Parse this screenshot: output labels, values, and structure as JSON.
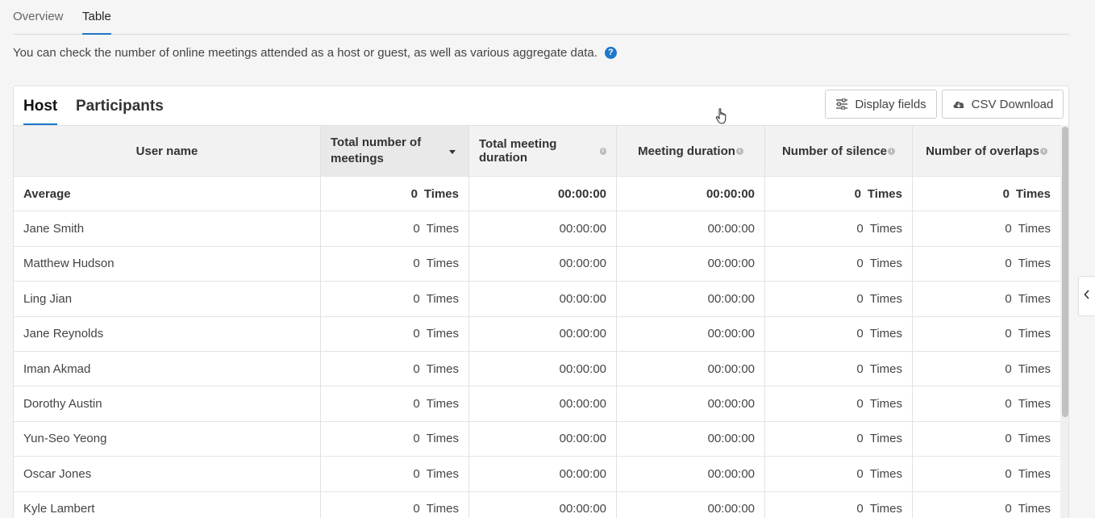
{
  "top_tabs": [
    {
      "label": "Overview",
      "active": false
    },
    {
      "label": "Table",
      "active": true
    }
  ],
  "description": "You can check the number of online meetings attended as a host or guest, as well as various aggregate data.",
  "inner_tabs": [
    {
      "label": "Host",
      "active": true
    },
    {
      "label": "Participants",
      "active": false
    }
  ],
  "buttons": {
    "display_fields": "Display fields",
    "csv_download": "CSV Download"
  },
  "columns": {
    "user_name": "User name",
    "total_meetings": "Total number of meetings",
    "total_duration": "Total meeting duration",
    "meeting_duration": "Meeting duration",
    "silence": "Number of silence",
    "overlaps": "Number of overlaps"
  },
  "unit": "Times",
  "average": {
    "label": "Average",
    "total_meetings": "0",
    "total_duration": "00:00:00",
    "meeting_duration": "00:00:00",
    "silence": "0",
    "overlaps": "0"
  },
  "rows": [
    {
      "name": "Jane Smith",
      "total_meetings": "0",
      "total_duration": "00:00:00",
      "meeting_duration": "00:00:00",
      "silence": "0",
      "overlaps": "0"
    },
    {
      "name": "Matthew Hudson",
      "total_meetings": "0",
      "total_duration": "00:00:00",
      "meeting_duration": "00:00:00",
      "silence": "0",
      "overlaps": "0"
    },
    {
      "name": "Ling Jian",
      "total_meetings": "0",
      "total_duration": "00:00:00",
      "meeting_duration": "00:00:00",
      "silence": "0",
      "overlaps": "0"
    },
    {
      "name": "Jane Reynolds",
      "total_meetings": "0",
      "total_duration": "00:00:00",
      "meeting_duration": "00:00:00",
      "silence": "0",
      "overlaps": "0"
    },
    {
      "name": "Iman Akmad",
      "total_meetings": "0",
      "total_duration": "00:00:00",
      "meeting_duration": "00:00:00",
      "silence": "0",
      "overlaps": "0"
    },
    {
      "name": "Dorothy Austin",
      "total_meetings": "0",
      "total_duration": "00:00:00",
      "meeting_duration": "00:00:00",
      "silence": "0",
      "overlaps": "0"
    },
    {
      "name": "Yun-Seo Yeong",
      "total_meetings": "0",
      "total_duration": "00:00:00",
      "meeting_duration": "00:00:00",
      "silence": "0",
      "overlaps": "0"
    },
    {
      "name": "Oscar Jones",
      "total_meetings": "0",
      "total_duration": "00:00:00",
      "meeting_duration": "00:00:00",
      "silence": "0",
      "overlaps": "0"
    },
    {
      "name": "Kyle Lambert",
      "total_meetings": "0",
      "total_duration": "00:00:00",
      "meeting_duration": "00:00:00",
      "silence": "0",
      "overlaps": "0"
    }
  ],
  "colors": {
    "accent": "#1f77c8",
    "header_bg": "#f2f2f2",
    "sorted_header_bg": "#e9e9e9"
  },
  "icons": {
    "help": "help-circle-icon",
    "info": "info-icon",
    "sort": "sort-desc-icon",
    "display_fields": "sliders-icon",
    "csv": "cloud-download-icon",
    "collapse": "chevron-left-icon"
  }
}
